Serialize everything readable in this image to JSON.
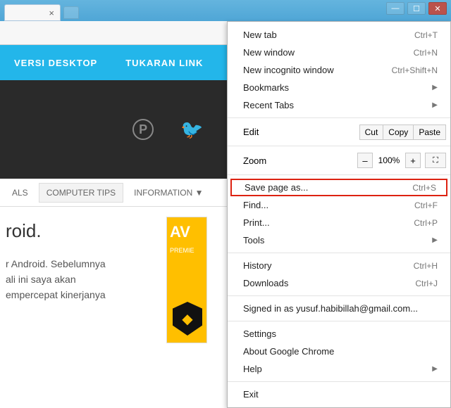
{
  "nav": {
    "versi": "VERSI DESKTOP",
    "tukaran": "TUKARAN LINK"
  },
  "tabs": {
    "als": "ALS",
    "tips": "COMPUTER TIPS",
    "info": "INFORMATION  ▼"
  },
  "article": {
    "title": "roid.",
    "line1": "r Android. Sebelumnya",
    "line2": "ali ini saya akan",
    "line3": "empercepat kinerjanya"
  },
  "ad": {
    "label": "AV",
    "sub": "PREMIE"
  },
  "menu": {
    "new_tab": "New tab",
    "new_tab_sc": "Ctrl+T",
    "new_window": "New window",
    "new_window_sc": "Ctrl+N",
    "incognito": "New incognito window",
    "incognito_sc": "Ctrl+Shift+N",
    "bookmarks": "Bookmarks",
    "recent": "Recent Tabs",
    "edit": "Edit",
    "cut": "Cut",
    "copy": "Copy",
    "paste": "Paste",
    "zoom": "Zoom",
    "zoom_minus": "–",
    "zoom_val": "100%",
    "zoom_plus": "+",
    "save": "Save page as...",
    "save_sc": "Ctrl+S",
    "find": "Find...",
    "find_sc": "Ctrl+F",
    "print": "Print...",
    "print_sc": "Ctrl+P",
    "tools": "Tools",
    "history": "History",
    "history_sc": "Ctrl+H",
    "downloads": "Downloads",
    "downloads_sc": "Ctrl+J",
    "signed": "Signed in as yusuf.habibillah@gmail.com...",
    "settings": "Settings",
    "about": "About Google Chrome",
    "help": "Help",
    "exit": "Exit"
  }
}
